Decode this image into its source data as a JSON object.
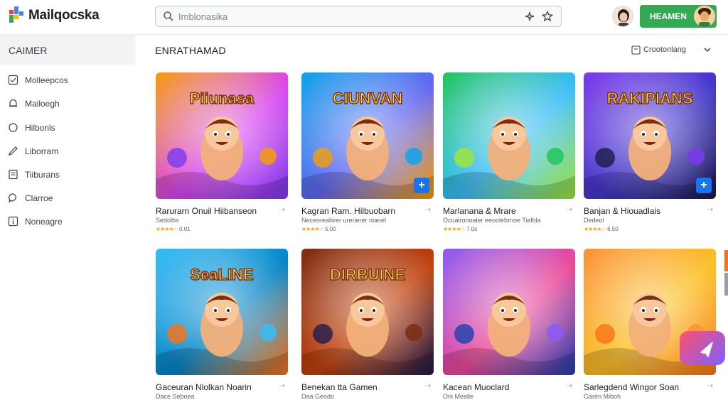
{
  "app": {
    "name": "Mailqocska"
  },
  "search": {
    "placeholder": "Imblonasika"
  },
  "header": {
    "primary_button": "HEAMEN"
  },
  "sidebar": {
    "heading": "CAIMER",
    "items": [
      {
        "label": "Molleepcos",
        "icon": "checklist-icon"
      },
      {
        "label": "Mailoegh",
        "icon": "bell-icon"
      },
      {
        "label": "Hilbonls",
        "icon": "circle-icon"
      },
      {
        "label": "Liborram",
        "icon": "pen-icon"
      },
      {
        "label": "Tiiburans",
        "icon": "document-icon"
      },
      {
        "label": "Clarroe",
        "icon": "chat-icon"
      },
      {
        "label": "Noneagre",
        "icon": "info-icon"
      }
    ]
  },
  "main": {
    "section_title": "ENRATHAMAD",
    "sort_label": "Crootonlang"
  },
  "cards": [
    {
      "title": "Rarurarn Onuil Hiibanseon",
      "subtitle": "Sedolbs",
      "stars": "★★★★☆",
      "rating": "0.01",
      "art_title": "Piiunasa",
      "colors": [
        "#f59e0b",
        "#d946ef",
        "#7c3aed"
      ]
    },
    {
      "title": "Kagran Ram. Hilbuobarn",
      "subtitle": "Necenrealiirer urerierer nianel",
      "stars": "★★★★☆",
      "rating": "5.00",
      "art_title": "CIUNVAN",
      "colors": [
        "#0ea5e9",
        "#6366f1",
        "#f59e0b"
      ]
    },
    {
      "title": "Marlanana & Mrare",
      "subtitle": "Ocuaironoaler eeoolebrnoe Tielbla",
      "stars": "★★★★☆",
      "rating": "7.0s",
      "art_title": "",
      "colors": [
        "#22c55e",
        "#38bdf8",
        "#a3e635"
      ]
    },
    {
      "title": "Banjan & Hiouadlais",
      "subtitle": "Dedeol",
      "stars": "★★★★☆",
      "rating": "6.50",
      "art_title": "RAKIPIANS",
      "colors": [
        "#7c3aed",
        "#4338ca",
        "#1e1b4b"
      ]
    },
    {
      "title": "Gaceuran Nlolkan Noarin",
      "subtitle": "Dace Seboea",
      "stars": "",
      "rating": "",
      "art_title": "SeaLINE",
      "colors": [
        "#38bdf8",
        "#0284c7",
        "#f97316"
      ]
    },
    {
      "title": "Benekan tta Gamen",
      "subtitle": "Daa Geodo",
      "stars": "",
      "rating": "",
      "art_title": "DIRBUINE",
      "colors": [
        "#7c2d12",
        "#c2410c",
        "#1e1b4b"
      ]
    },
    {
      "title": "Kacean Muoclard",
      "subtitle": "Oni Mealle",
      "stars": "",
      "rating": "",
      "art_title": "",
      "colors": [
        "#8b5cf6",
        "#ec4899",
        "#1e40af"
      ]
    },
    {
      "title": "Sarlegdend Wingor Soan",
      "subtitle": "Garen Miboh",
      "stars": "",
      "rating": "",
      "art_title": "",
      "colors": [
        "#fb923c",
        "#fbbf24",
        "#f97316"
      ]
    }
  ]
}
